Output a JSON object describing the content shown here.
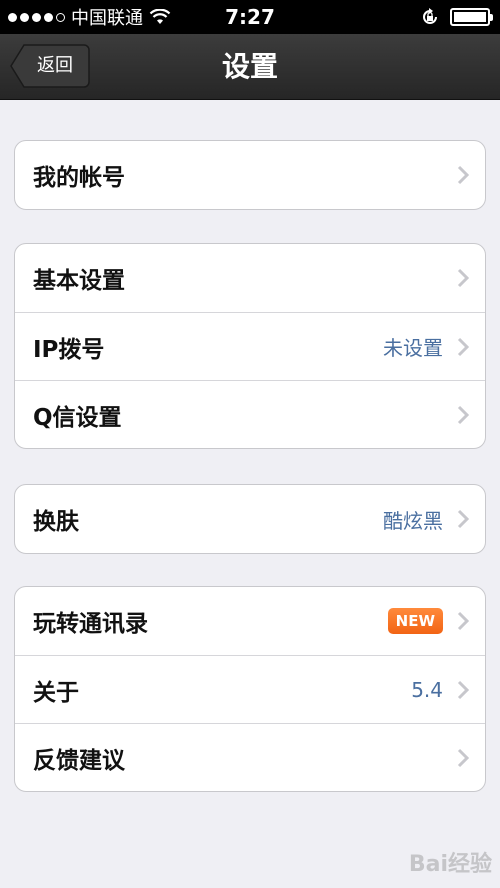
{
  "status_bar": {
    "carrier": "中国联通",
    "time": "7:27"
  },
  "nav": {
    "back_label": "返回",
    "title": "设置"
  },
  "groups": [
    {
      "items": [
        {
          "label": "我的帐号"
        }
      ]
    },
    {
      "items": [
        {
          "label": "基本设置"
        },
        {
          "label": "IP拨号",
          "value": "未设置"
        },
        {
          "label": "Q信设置"
        }
      ]
    },
    {
      "items": [
        {
          "label": "换肤",
          "value": "酷炫黑"
        }
      ]
    },
    {
      "items": [
        {
          "label": "玩转通讯录",
          "badge": "NEW"
        },
        {
          "label": "关于",
          "value": "5.4"
        },
        {
          "label": "反馈建议"
        }
      ]
    }
  ],
  "watermark": "Bai经验"
}
